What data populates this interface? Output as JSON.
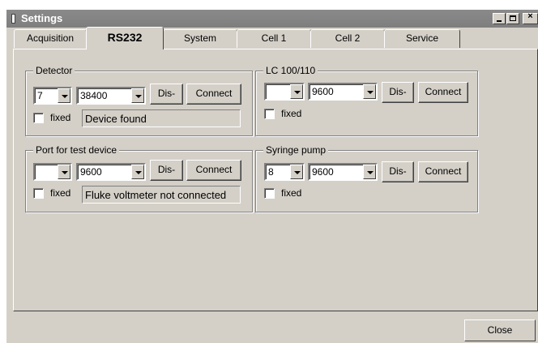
{
  "window": {
    "title": "Settings"
  },
  "tabs": [
    {
      "label": "Acquisition"
    },
    {
      "label": "RS232",
      "active": true
    },
    {
      "label": "System"
    },
    {
      "label": "Cell 1"
    },
    {
      "label": "Cell 2"
    },
    {
      "label": "Service"
    }
  ],
  "groups": {
    "detector": {
      "title": "Detector",
      "port": "7",
      "baud": "38400",
      "disconnect_label": "Dis-",
      "connect_label": "Connect",
      "fixed_label": "fixed",
      "fixed_checked": false,
      "status": "Device found"
    },
    "lc": {
      "title": "LC 100/110",
      "port": "",
      "baud": "9600",
      "disconnect_label": "Dis-",
      "connect_label": "Connect",
      "fixed_label": "fixed",
      "fixed_checked": false
    },
    "test_device": {
      "title": "Port for test device",
      "port": "",
      "baud": "9600",
      "disconnect_label": "Dis-",
      "connect_label": "Connect",
      "fixed_label": "fixed",
      "fixed_checked": false,
      "status": "Fluke voltmeter not connected"
    },
    "syringe": {
      "title": "Syringe pump",
      "port": "8",
      "baud": "9600",
      "disconnect_label": "Dis-",
      "connect_label": "Connect",
      "fixed_label": "fixed",
      "fixed_checked": false
    }
  },
  "footer": {
    "close_label": "Close"
  },
  "icons": {
    "window": "window-icon",
    "minimize": "minimize-icon",
    "maximize": "maximize-icon",
    "close": "close-icon",
    "dropdown": "chevron-down-icon"
  }
}
